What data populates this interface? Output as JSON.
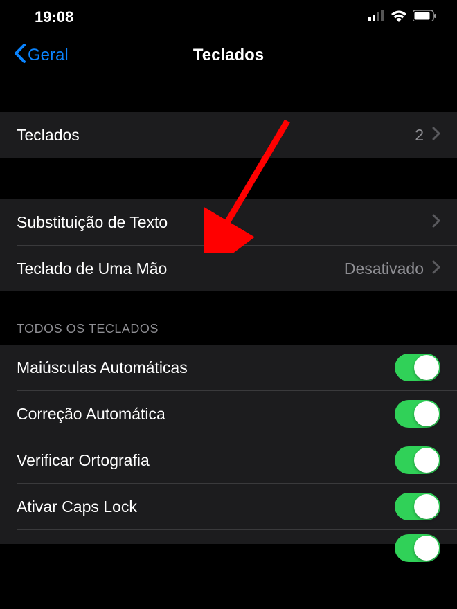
{
  "statusBar": {
    "time": "19:08"
  },
  "nav": {
    "back": "Geral",
    "title": "Teclados"
  },
  "group1": {
    "keyboards": {
      "label": "Teclados",
      "value": "2"
    }
  },
  "group2": {
    "textReplacement": "Substituição de Texto",
    "oneHanded": {
      "label": "Teclado de Uma Mão",
      "value": "Desativado"
    }
  },
  "sectionHeader": "TODOS OS TECLADOS",
  "toggles": {
    "autoCaps": "Maiúsculas Automáticas",
    "autoCorrect": "Correção Automática",
    "spellCheck": "Verificar Ortografia",
    "capsLock": "Ativar Caps Lock"
  },
  "annotation": {
    "arrowColor": "#ff0000"
  }
}
